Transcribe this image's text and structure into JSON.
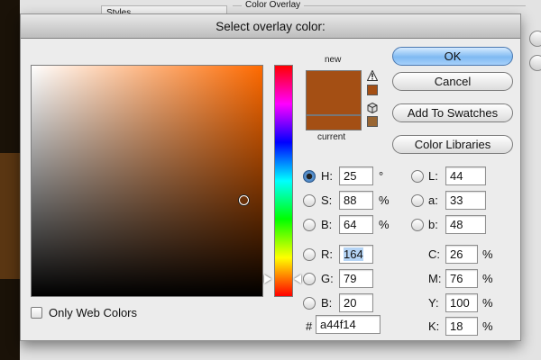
{
  "background": {
    "styles_label": "Styles",
    "group_label": "Color Overlay"
  },
  "dialog": {
    "title": "Select overlay color:",
    "only_web_colors_label": "Only Web Colors",
    "only_web_colors_checked": false
  },
  "preview": {
    "new_label": "new",
    "current_label": "current",
    "new_color": "#a44f14",
    "current_color": "#a44f14",
    "gamut_warning_color": "#a44f14",
    "web_safe_color": "#996633"
  },
  "buttons": {
    "ok": "OK",
    "cancel": "Cancel",
    "add_to_swatches": "Add To Swatches",
    "color_libraries": "Color Libraries"
  },
  "hsb": {
    "h_label": "H:",
    "h_value": "25",
    "h_unit": "°",
    "s_label": "S:",
    "s_value": "88",
    "s_unit": "%",
    "b_label": "B:",
    "b_value": "64",
    "b_unit": "%"
  },
  "rgb": {
    "r_label": "R:",
    "r_value": "164",
    "g_label": "G:",
    "g_value": "79",
    "b_label": "B:",
    "b_value": "20"
  },
  "lab": {
    "l_label": "L:",
    "l_value": "44",
    "a_label": "a:",
    "a_value": "33",
    "b_label": "b:",
    "b_value": "48"
  },
  "cmyk": {
    "c_label": "C:",
    "c_value": "26",
    "c_unit": "%",
    "m_label": "M:",
    "m_value": "76",
    "m_unit": "%",
    "y_label": "Y:",
    "y_value": "100",
    "y_unit": "%",
    "k_label": "K:",
    "k_value": "18",
    "k_unit": "%"
  },
  "hex": {
    "label": "#",
    "value": "a44f14"
  },
  "selected_mode": "H"
}
